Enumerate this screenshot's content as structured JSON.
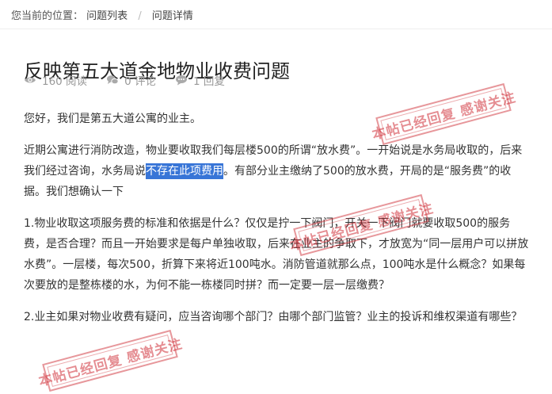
{
  "breadcrumb": {
    "prefix": "您当前的位置：",
    "items": [
      "问题列表",
      "问题详情"
    ],
    "separator": "/"
  },
  "page": {
    "title": "反映第五大道金地物业收费问题"
  },
  "stats": {
    "views": "160 阅读",
    "comments": "0 评论",
    "replies": "1 回复"
  },
  "content": {
    "p1": "您好，我们是第五大道公寓的业主。",
    "p2_before": "近期公寓进行消防改造，物业要收取我们每层楼500的所谓“放水费”。一开始说是水务局收取的，后来我们经过咨询，水务局说",
    "p2_highlight": "不存在此项费用",
    "p2_after": "。有部分业主缴纳了500的放水费，开局的是“服务费”的收据。我们想确认一下",
    "p3": "1.物业收取这项服务费的标准和依据是什么？仅仅是拧一下阀门，开关一下阀门就要收取500的服务费，是否合理？而且一开始要求是每户单独收取，后来在业主的争取下，才放宽为“同一层用户可以拼放水费”。一层楼，每次500，折算下来将近100吨水。消防管道就那么点，100吨水是什么概念？如果每次要放的是整栋楼的水，为何不能一栋楼同时拼？而一定要一层一层缴费？",
    "p4": "2.业主如果对物业收费有疑问，应当咨询哪个部门？由哪个部门监管？业主的投诉和维权渠道有哪些？"
  },
  "stamps": {
    "text": "本帖已经回复 感谢关注"
  },
  "colors": {
    "highlight": "#3875d7",
    "stamp": "#d03038",
    "meta": "#999999"
  }
}
